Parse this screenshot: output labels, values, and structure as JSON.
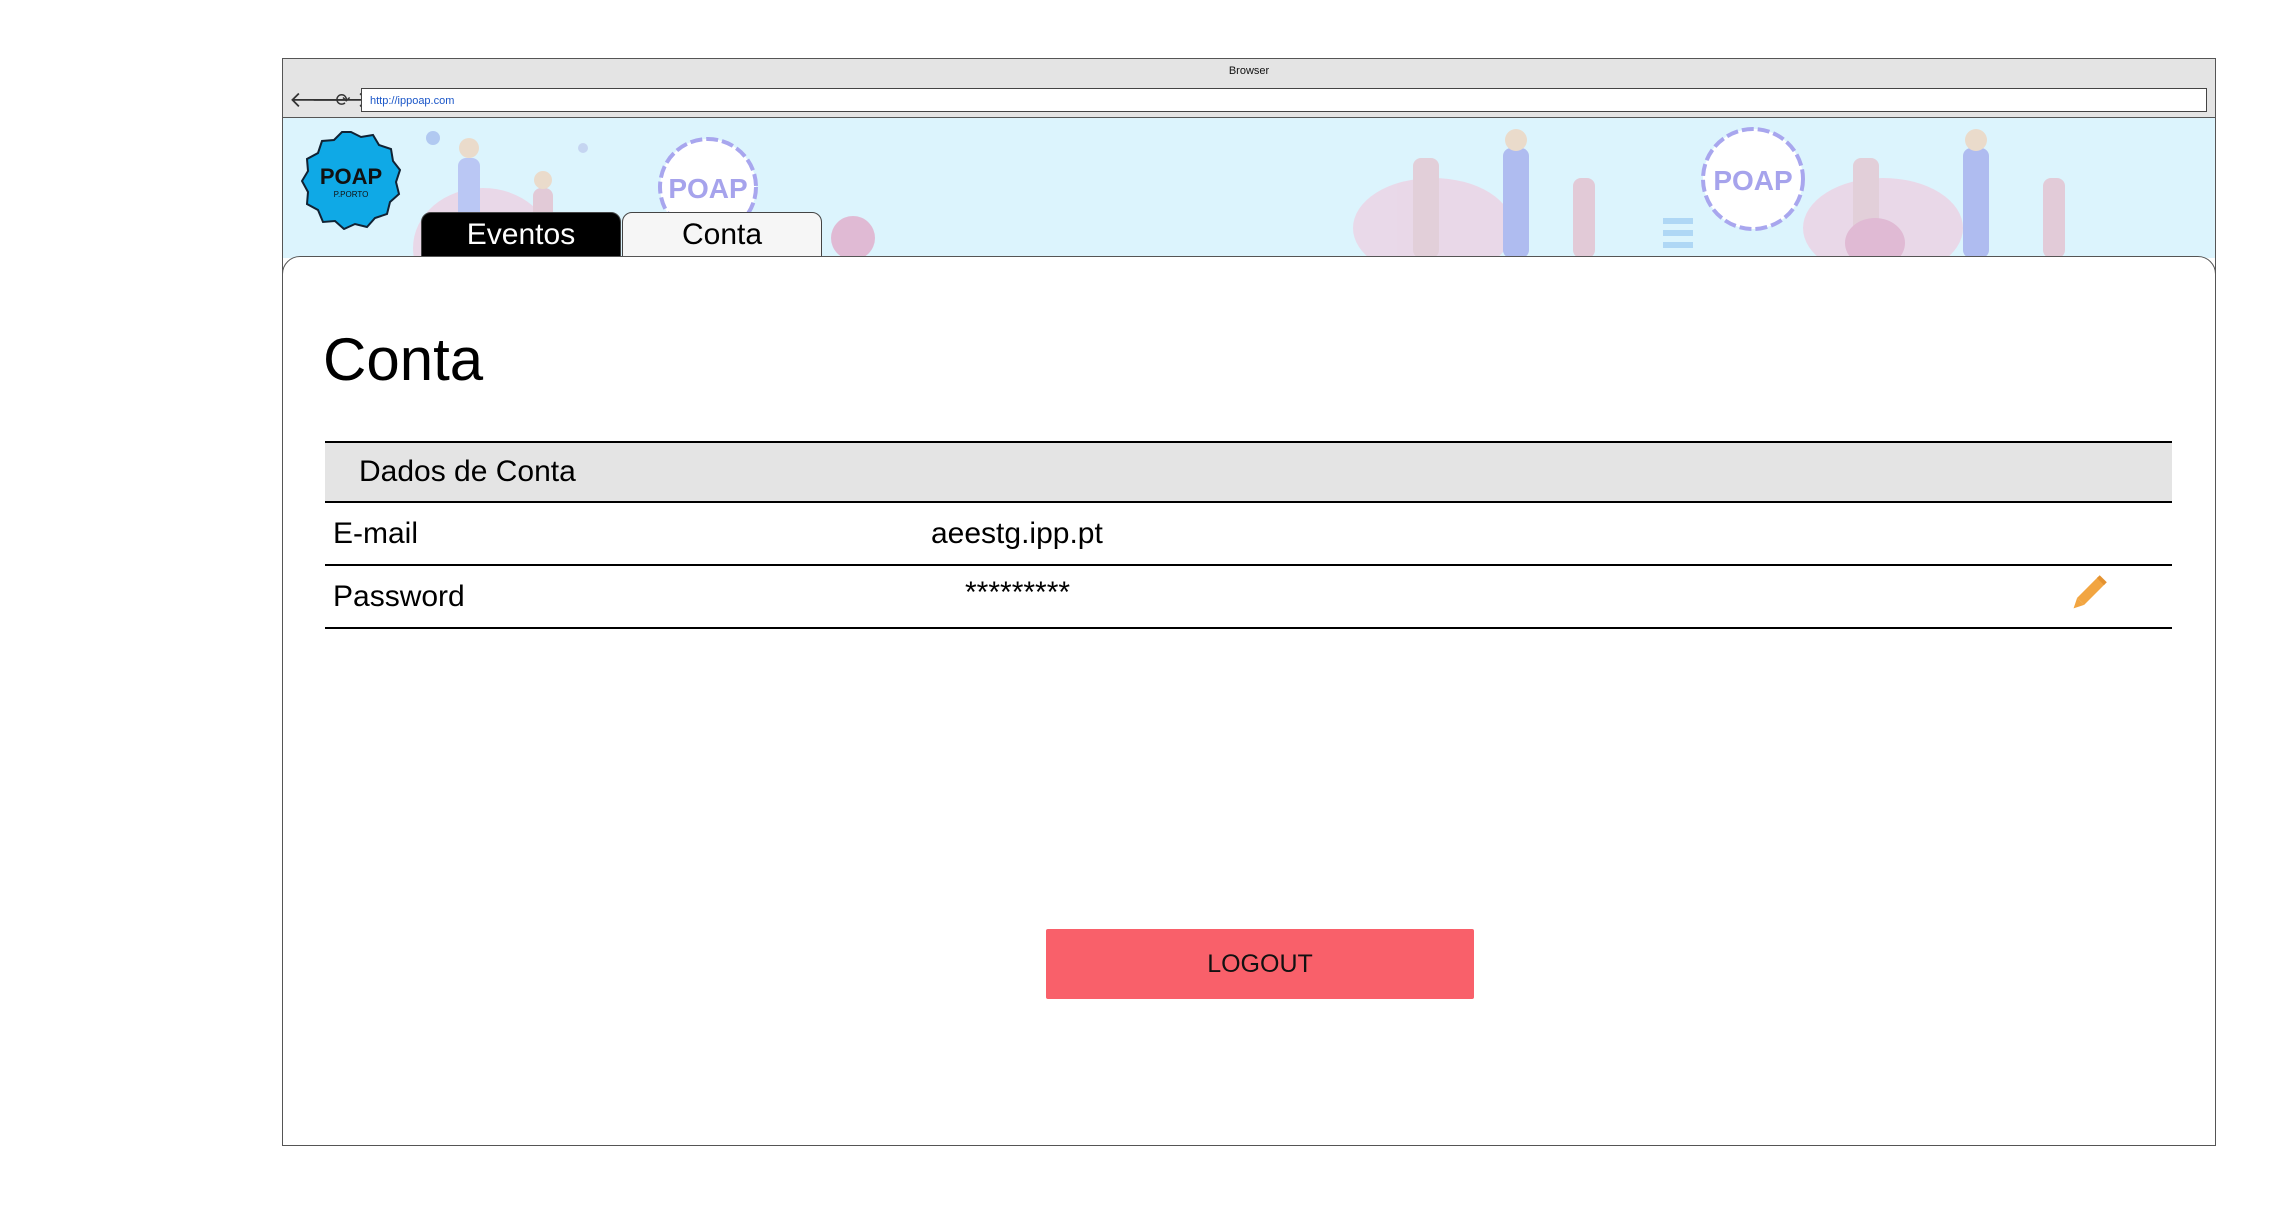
{
  "browser": {
    "title": "Browser",
    "url": "http://ippoap.com",
    "back_icon": "arrow-left-icon",
    "forward_icon": "arrow-right-icon",
    "reload_icon": "reload-icon"
  },
  "header": {
    "logo": {
      "text": "POAP",
      "subtext": "P.PORTO"
    },
    "banner_badge_text": "POAP",
    "tabs": [
      {
        "label": "Eventos",
        "active": true
      },
      {
        "label": "Conta",
        "active": false
      }
    ]
  },
  "main": {
    "title": "Conta",
    "account_table": {
      "header": "Dados de Conta",
      "rows": [
        {
          "label": "E-mail",
          "value": "aeestg.ipp.pt"
        },
        {
          "label": "Password",
          "value": "*********",
          "action_icon": "pencil-icon"
        }
      ]
    },
    "logout_label": "LOGOUT"
  },
  "colors": {
    "banner_bg": "#dcf4fd",
    "logo_bg": "#0fa9e6",
    "logout_bg": "#f9606a",
    "edit_icon": "#f2a541"
  }
}
